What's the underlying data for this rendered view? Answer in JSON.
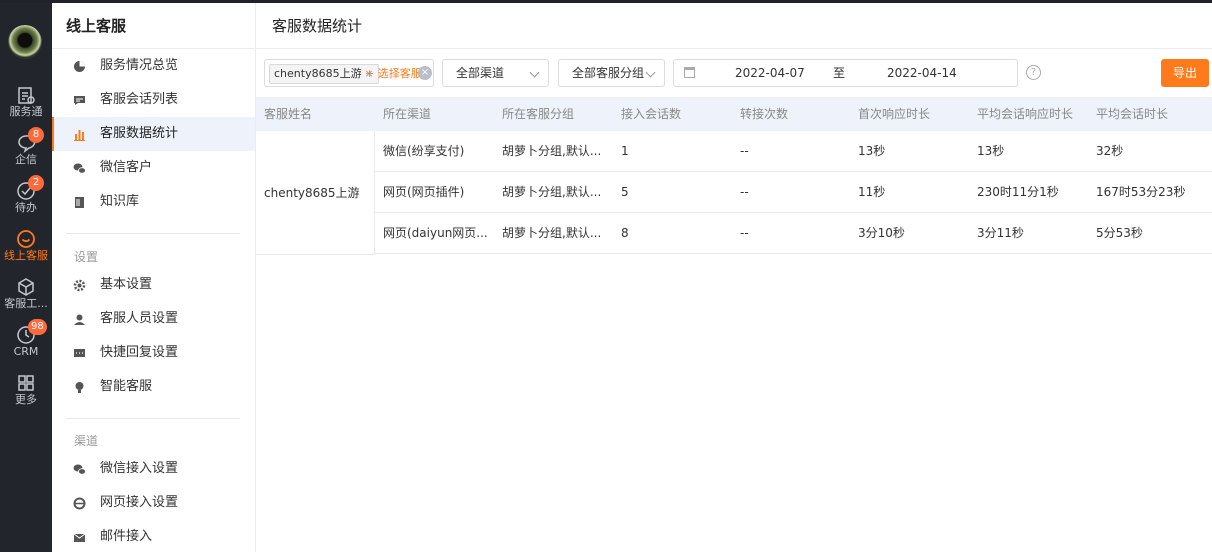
{
  "rail": {
    "items": [
      {
        "label": "服务通",
        "icon": "clipboard-icon",
        "badge": ""
      },
      {
        "label": "企信",
        "icon": "chat-bubble-icon",
        "badge": "8"
      },
      {
        "label": "待办",
        "icon": "check-circle-icon",
        "badge": "2"
      },
      {
        "label": "线上客服",
        "icon": "smile-chat-icon",
        "badge": ""
      },
      {
        "label": "客服工...",
        "icon": "cube-icon",
        "badge": ""
      },
      {
        "label": "CRM",
        "icon": "clock-icon",
        "badge": "98"
      },
      {
        "label": "更多",
        "icon": "grid-icon",
        "badge": ""
      }
    ],
    "active_color": "#ff7a1a"
  },
  "menu": {
    "title": "线上客服",
    "items": [
      {
        "label": "服务情况总览",
        "icon": "pie-chart-icon"
      },
      {
        "label": "客服会话列表",
        "icon": "message-icon"
      },
      {
        "label": "客服数据统计",
        "icon": "bar-chart-icon"
      },
      {
        "label": "微信客户",
        "icon": "wechat-icon"
      },
      {
        "label": "知识库",
        "icon": "book-icon"
      }
    ],
    "settings_group": "设置",
    "settings": [
      {
        "label": "基本设置",
        "icon": "gear-icon"
      },
      {
        "label": "客服人员设置",
        "icon": "agent-icon"
      },
      {
        "label": "快捷回复设置",
        "icon": "quick-reply-icon"
      },
      {
        "label": "智能客服",
        "icon": "bulb-icon"
      }
    ],
    "channel_group": "渠道",
    "channels": [
      {
        "label": "微信接入设置",
        "icon": "wechat-icon"
      },
      {
        "label": "网页接入设置",
        "icon": "browser-icon"
      },
      {
        "label": "邮件接入",
        "icon": "mail-icon"
      }
    ]
  },
  "page": {
    "title": "客服数据统计"
  },
  "filters": {
    "agent_tag": "chenty8685上游",
    "tag_remove": "×",
    "add_agent": "+ 选择客服",
    "clear": "×",
    "channel": "全部渠道",
    "group": "全部客服分组",
    "date_from": "2022-04-07",
    "date_sep": "至",
    "date_to": "2022-04-14",
    "help": "?",
    "export": "导出"
  },
  "table": {
    "columns": [
      "客服姓名",
      "所在渠道",
      "所在客服分组",
      "接入会话数",
      "转接次数",
      "首次响应时长",
      "平均会话响应时长",
      "平均会话时长"
    ],
    "agent": "chenty8685上游",
    "rows": [
      {
        "channel": "微信(纷享支付)",
        "group": "胡萝卜分组,默认...",
        "sessions": "1",
        "transfers": "--",
        "first_resp": "13秒",
        "avg_resp": "13秒",
        "avg_dur": "32秒"
      },
      {
        "channel": "网页(网页插件)",
        "group": "胡萝卜分组,默认...",
        "sessions": "5",
        "transfers": "--",
        "first_resp": "11秒",
        "avg_resp": "230时11分1秒",
        "avg_dur": "167时53分23秒"
      },
      {
        "channel": "网页(daiyun网页...",
        "group": "胡萝卜分组,默认...",
        "sessions": "8",
        "transfers": "--",
        "first_resp": "3分10秒",
        "avg_resp": "3分11秒",
        "avg_dur": "5分53秒"
      }
    ]
  }
}
